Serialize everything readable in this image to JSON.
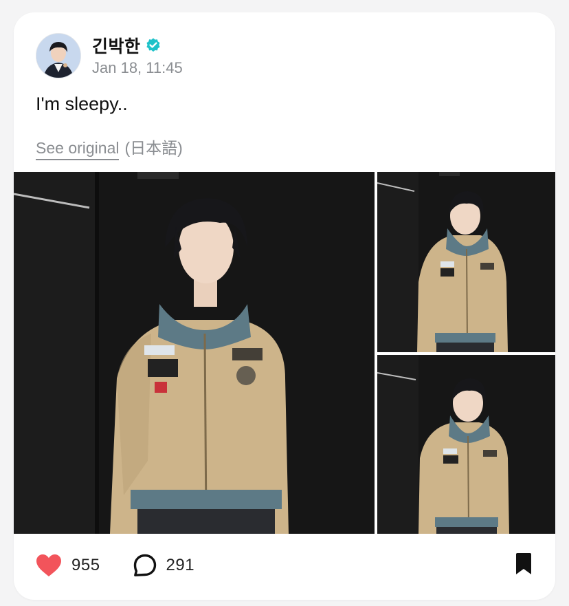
{
  "post": {
    "author": {
      "name": "긴박한",
      "verified": true,
      "verified_color": "#1fc2c9"
    },
    "timestamp": "Jan 18, 11:45",
    "text": "I'm sleepy..",
    "translation": {
      "link_label": "See original",
      "language": "(日本語)"
    },
    "photos": [
      {
        "icon": "photo-main"
      },
      {
        "icon": "photo-top-right"
      },
      {
        "icon": "photo-bottom-right"
      }
    ],
    "actions": {
      "likes": "955",
      "comments": "291",
      "like_color": "#f2545b"
    }
  }
}
